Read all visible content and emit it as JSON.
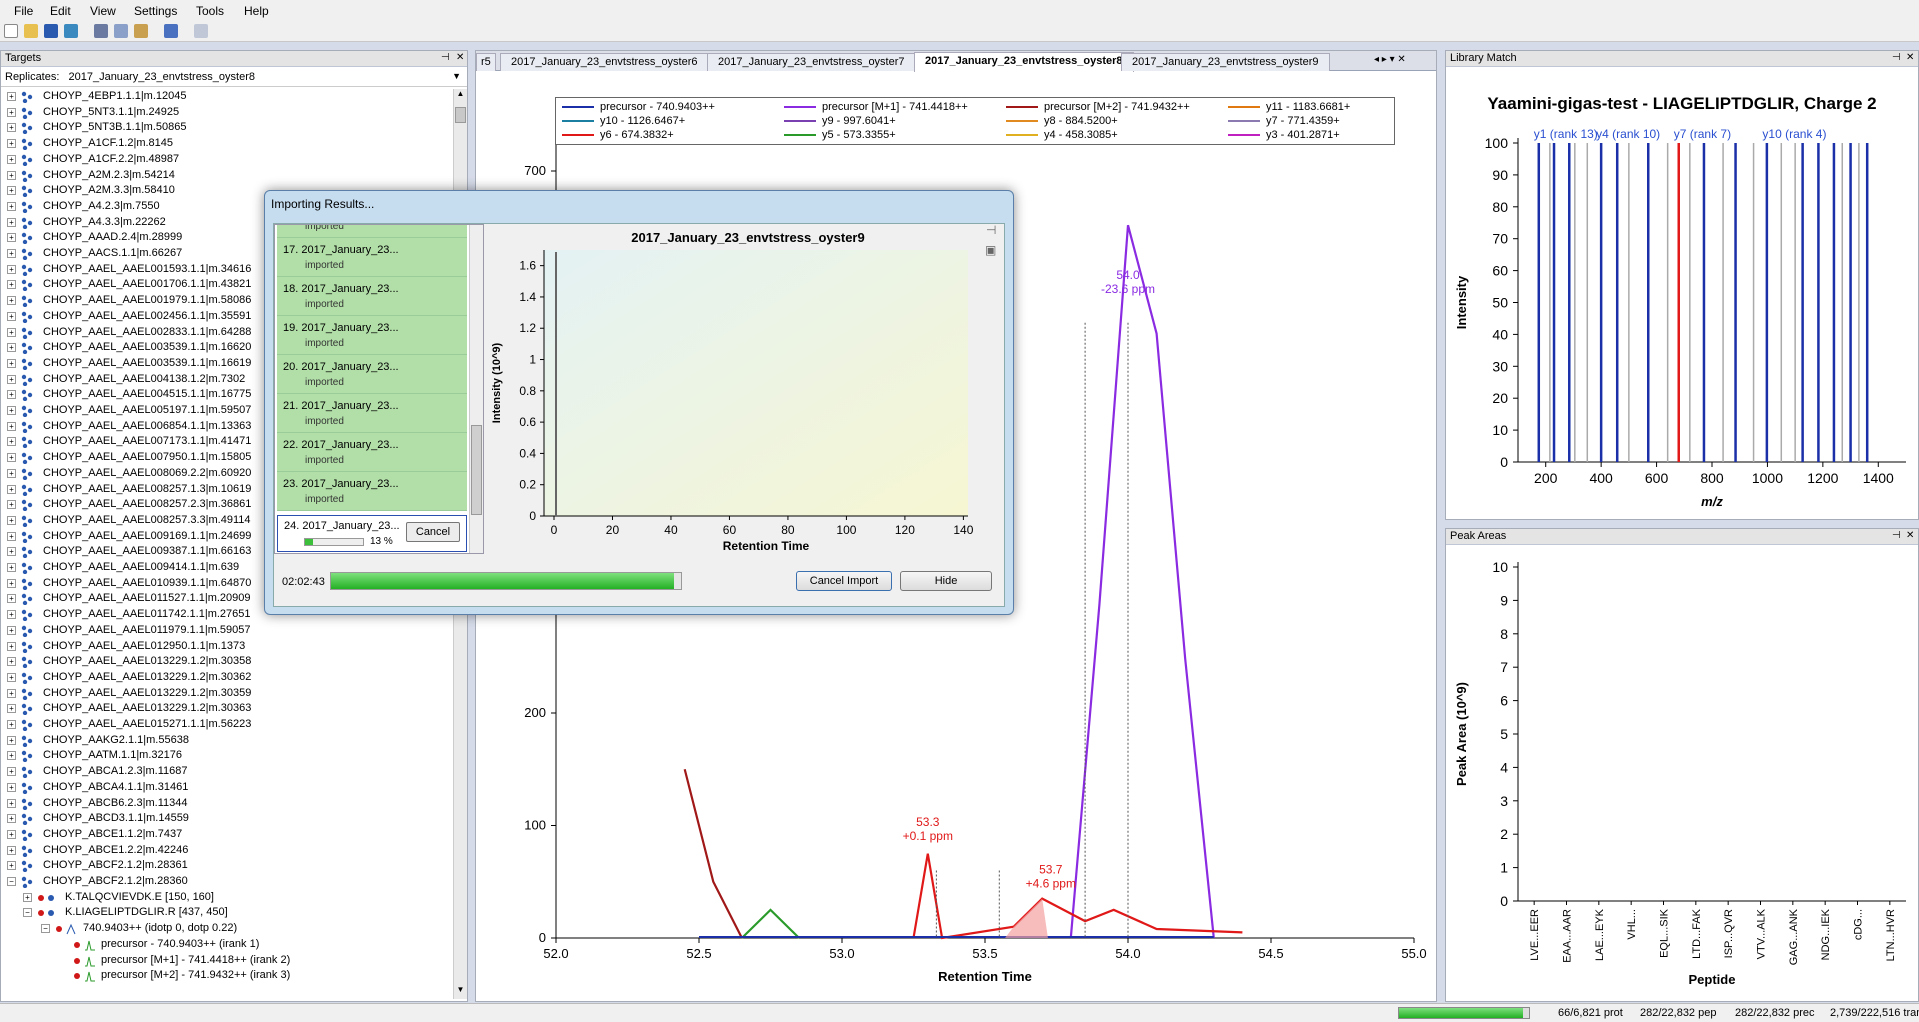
{
  "menu": [
    "File",
    "Edit",
    "View",
    "Settings",
    "Tools",
    "Help"
  ],
  "targets": {
    "title": "Targets",
    "replicates_label": "Replicates:",
    "replicates_value": "2017_January_23_envtstress_oyster8",
    "items": [
      "CHOYP_4EBP1.1.1|m.12045",
      "CHOYP_5NT3.1.1|m.24925",
      "CHOYP_5NT3B.1.1|m.50865",
      "CHOYP_A1CF.1.2|m.8145",
      "CHOYP_A1CF.2.2|m.48987",
      "CHOYP_A2M.2.3|m.54214",
      "CHOYP_A2M.3.3|m.58410",
      "CHOYP_A4.2.3|m.7550",
      "CHOYP_A4.3.3|m.22262",
      "CHOYP_AAAD.2.4|m.28999",
      "CHOYP_AACS.1.1|m.66267",
      "CHOYP_AAEL_AAEL001593.1.1|m.34616",
      "CHOYP_AAEL_AAEL001706.1.1|m.43821",
      "CHOYP_AAEL_AAEL001979.1.1|m.58086",
      "CHOYP_AAEL_AAEL002456.1.1|m.35591",
      "CHOYP_AAEL_AAEL002833.1.1|m.64288",
      "CHOYP_AAEL_AAEL003539.1.1|m.16620",
      "CHOYP_AAEL_AAEL003539.1.1|m.16619",
      "CHOYP_AAEL_AAEL004138.1.2|m.7302",
      "CHOYP_AAEL_AAEL004515.1.1|m.16775",
      "CHOYP_AAEL_AAEL005197.1.1|m.59507",
      "CHOYP_AAEL_AAEL006854.1.1|m.13363",
      "CHOYP_AAEL_AAEL007173.1.1|m.41471",
      "CHOYP_AAEL_AAEL007950.1.1|m.15805",
      "CHOYP_AAEL_AAEL008069.2.2|m.60920",
      "CHOYP_AAEL_AAEL008257.1.3|m.10619",
      "CHOYP_AAEL_AAEL008257.2.3|m.36861",
      "CHOYP_AAEL_AAEL008257.3.3|m.49114",
      "CHOYP_AAEL_AAEL009169.1.1|m.24699",
      "CHOYP_AAEL_AAEL009387.1.1|m.66163",
      "CHOYP_AAEL_AAEL009414.1.1|m.639",
      "CHOYP_AAEL_AAEL010939.1.1|m.64870",
      "CHOYP_AAEL_AAEL011527.1.1|m.20909",
      "CHOYP_AAEL_AAEL011742.1.1|m.27651",
      "CHOYP_AAEL_AAEL011979.1.1|m.59057",
      "CHOYP_AAEL_AAEL012950.1.1|m.1373",
      "CHOYP_AAEL_AAEL013229.1.2|m.30358",
      "CHOYP_AAEL_AAEL013229.1.2|m.30362",
      "CHOYP_AAEL_AAEL013229.1.2|m.30359",
      "CHOYP_AAEL_AAEL013229.1.2|m.30363",
      "CHOYP_AAEL_AAEL015271.1.1|m.56223",
      "CHOYP_AAKG2.1.1|m.55638",
      "CHOYP_AATM.1.1|m.32176",
      "CHOYP_ABCA1.2.3|m.11687",
      "CHOYP_ABCA4.1.1|m.31461",
      "CHOYP_ABCB6.2.3|m.11344",
      "CHOYP_ABCD3.1.1|m.14559",
      "CHOYP_ABCE1.1.2|m.7437",
      "CHOYP_ABCE1.2.2|m.42246",
      "CHOYP_ABCF2.1.2|m.28361",
      "CHOYP_ABCF2.1.2|m.28360"
    ],
    "sub": [
      "K.TALQCVIEVDK.E [150, 160]",
      "K.LIAGELIPTDGLIR.R [437, 450]",
      "740.9403++ (idotp 0, dotp 0.22)",
      "precursor - 740.9403++ (irank 1)",
      "precursor [M+1] - 741.4418++ (irank 2)",
      "precursor [M+2] - 741.9432++ (irank 3)"
    ]
  },
  "tabs": [
    "r5",
    "2017_January_23_envtstress_oyster6",
    "2017_January_23_envtstress_oyster7",
    "2017_January_23_envtstress_oyster8",
    "2017_January_23_envtstress_oyster9"
  ],
  "legend": [
    {
      "label": "precursor - 740.9403++",
      "color": "#1a2fa8"
    },
    {
      "label": "precursor [M+1] - 741.4418++",
      "color": "#8a2be2"
    },
    {
      "label": "precursor [M+2] - 741.9432++",
      "color": "#a01818"
    },
    {
      "label": "y11 - 1183.6681+",
      "color": "#e07a10"
    },
    {
      "label": "y10 - 1126.6467+",
      "color": "#1a7fa0"
    },
    {
      "label": "y9 - 997.6041+",
      "color": "#7a3fb0"
    },
    {
      "label": "y8 - 884.5200+",
      "color": "#e08a20"
    },
    {
      "label": "y7 - 771.4359+",
      "color": "#8a7ab0"
    },
    {
      "label": "y6 - 674.3832+",
      "color": "#e01818"
    },
    {
      "label": "y5 - 573.3355+",
      "color": "#2a9a2a"
    },
    {
      "label": "y4 - 458.3085+",
      "color": "#e0b020"
    },
    {
      "label": "y3 - 401.2871+",
      "color": "#c020c0"
    }
  ],
  "main_chart": {
    "xlabel": "Retention Time",
    "x_ticks": [
      "52.0",
      "52.5",
      "53.0",
      "53.5",
      "54.0",
      "54.5",
      "55.0"
    ],
    "y_ticks": [
      "0",
      "100",
      "200",
      "700"
    ],
    "annotations": [
      {
        "rt": "53.3",
        "ppm": "+0.1 ppm",
        "color": "#e01818"
      },
      {
        "rt": "53.7",
        "ppm": "+4.6 ppm",
        "color": "#e01818"
      },
      {
        "rt": "54.0",
        "ppm": "-23.6 ppm",
        "color": "#8a2be2"
      }
    ]
  },
  "dialog": {
    "title": "Importing Results...",
    "results": [
      {
        "name": "17. 2017_January_23...",
        "status": "imported"
      },
      {
        "name": "18. 2017_January_23...",
        "status": "imported"
      },
      {
        "name": "19. 2017_January_23...",
        "status": "imported"
      },
      {
        "name": "20. 2017_January_23...",
        "status": "imported"
      },
      {
        "name": "21. 2017_January_23...",
        "status": "imported"
      },
      {
        "name": "22. 2017_January_23...",
        "status": "imported"
      },
      {
        "name": "23. 2017_January_23...",
        "status": "imported"
      }
    ],
    "partial_status": "imported",
    "current": {
      "name": "24. 2017_January_23...",
      "percent": "13 %",
      "cancel": "Cancel"
    },
    "chart_title": "2017_January_23_envtstress_oyster9",
    "chart_ylabel": "Intensity (10^9)",
    "chart_xlabel": "Retention Time",
    "chart_y_ticks": [
      "0",
      "0.2",
      "0.4",
      "0.6",
      "0.8",
      "1",
      "1.2",
      "1.4",
      "1.6"
    ],
    "chart_x_ticks": [
      "0",
      "20",
      "40",
      "60",
      "80",
      "100",
      "120",
      "140"
    ],
    "elapsed": "02:02:43",
    "progress": 0.98,
    "cancel_import": "Cancel Import",
    "hide": "Hide"
  },
  "library": {
    "panel_title": "Library Match",
    "title": "Yaamini-gigas-test - LIAGELIPTDGLIR, Charge 2",
    "ylabel": "Intensity",
    "xlabel": "m/z",
    "y_ticks": [
      "0",
      "10",
      "20",
      "30",
      "40",
      "50",
      "60",
      "70",
      "80",
      "90",
      "100"
    ],
    "x_ticks": [
      "200",
      "400",
      "600",
      "800",
      "1000",
      "1200",
      "1400"
    ],
    "labels": [
      "y1 (rank 13)",
      "y4 (rank 10)",
      "y7 (rank 7)",
      "y10 (rank 4)"
    ]
  },
  "peak_areas": {
    "panel_title": "Peak Areas",
    "ylabel": "Peak Area (10^9)",
    "xlabel": "Peptide",
    "y_ticks": [
      "0",
      "1",
      "2",
      "3",
      "4",
      "5",
      "6",
      "7",
      "8",
      "9",
      "10"
    ],
    "categories": [
      "LVE...EER",
      "EAA...AAR",
      "LAE...EYK",
      "VHL...",
      "EQL...SIK",
      "LTD...FAK",
      "ISP...QVR",
      "VTV...ALK",
      "GAG...ANK",
      "NDG...IEK",
      "cDG...",
      "LTN...HVR"
    ]
  },
  "chart_data": [
    {
      "type": "line",
      "title": "",
      "xlabel": "Retention Time",
      "ylabel": "",
      "xlim": [
        52.0,
        55.0
      ],
      "ylim": [
        0,
        700
      ],
      "series": [
        {
          "name": "precursor [M+1] - 741.4418++",
          "x": [
            53.8,
            53.9,
            54.0,
            54.1,
            54.2,
            54.3
          ],
          "values": [
            0,
            300,
            650,
            550,
            250,
            0
          ]
        },
        {
          "name": "y6 - 674.3832+",
          "x": [
            53.25,
            53.3,
            53.35,
            53.6,
            53.7,
            53.85,
            53.95,
            54.1,
            54.4
          ],
          "values": [
            0,
            75,
            0,
            10,
            35,
            15,
            25,
            8,
            5
          ]
        },
        {
          "name": "precursor [M+2] - 741.9432++",
          "x": [
            52.45,
            52.55,
            52.65
          ],
          "values": [
            150,
            50,
            0
          ]
        },
        {
          "name": "y5 - 573.3355+",
          "x": [
            52.65,
            52.75,
            52.85
          ],
          "values": [
            0,
            25,
            0
          ]
        }
      ]
    },
    {
      "type": "bar",
      "title": "Yaamini-gigas-test - LIAGELIPTDGLIR, Charge 2",
      "xlabel": "m/z",
      "ylabel": "Intensity",
      "xlim": [
        100,
        1500
      ],
      "ylim": [
        0,
        100
      ],
      "x": [
        175,
        230,
        285,
        400,
        458,
        570,
        680,
        771,
        885,
        998,
        1127,
        1184,
        1240,
        1300,
        1360
      ],
      "values": [
        100,
        100,
        100,
        100,
        100,
        100,
        100,
        100,
        100,
        100,
        100,
        100,
        100,
        100,
        100
      ]
    }
  ],
  "status": {
    "prot": "66/6,821 prot",
    "pep": "282/22,832 pep",
    "prec": "282/22,832 prec",
    "tran": "2,739/222,516 tran",
    "progress": 0.95
  }
}
